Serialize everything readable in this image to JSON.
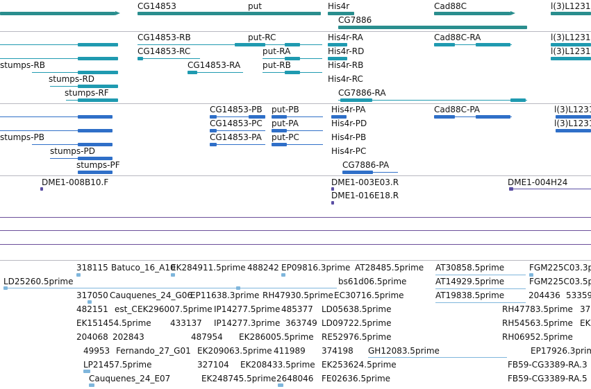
{
  "colors": {
    "gene": "#2a8e8e",
    "rna": "#1f9ab0",
    "cds": "#2f6fc8",
    "clone": "#5b4fa4",
    "est": "#7fb6dc",
    "track_line": "#6b4e9a",
    "separator": "#b8b8c0"
  },
  "genes": [
    "CG14853",
    "put",
    "His4r",
    "CG7886",
    "Cad88C",
    "l(3)L1231"
  ],
  "transcripts": [
    "CG14853-RB",
    "put-RC",
    "His4r-RA",
    "Cad88C-RA",
    "l(3)L1231",
    "CG14853-RC",
    "put-RA",
    "His4r-RD",
    "l(3)L1231",
    "stumps-RB",
    "CG14853-RA",
    "put-RB",
    "His4r-RB",
    "stumps-RD",
    "His4r-RC",
    "stumps-RF",
    "CG7886-RA"
  ],
  "proteins": [
    "CG14853-PB",
    "put-PB",
    "His4r-PA",
    "Cad88C-PA",
    "l(3)L1231",
    "CG14853-PC",
    "put-PA",
    "His4r-PD",
    "l(3)L1231",
    "stumps-PB",
    "CG14853-PA",
    "put-PC",
    "His4r-PB",
    "stumps-PD",
    "His4r-PC",
    "stumps-PF",
    "CG7886-PA"
  ],
  "clones": [
    "DME1-008B10.F",
    "DME1-003E03.R",
    "DME1-004H24",
    "DME1-016E18.R"
  ],
  "ests": [
    "318115",
    "Batuco_16_A10",
    "EK284911.5prime",
    "488242",
    "EP09816.3prime",
    "AT28485.5prime",
    "AT30858.5prime",
    "FGM225C03.3p",
    "LD25260.5prime",
    "bs61d06.5prime",
    "317050",
    "Cauquenes_24_G06",
    "EP11638.3prime",
    "RH47930.5prime",
    "EC30716.5prime",
    "AT14929.5prime",
    "FGM225C03.5p",
    "482151",
    "est_C",
    "EK296007.5prime",
    "IP14277.5prime",
    "485377",
    "LD05638.5prime",
    "AT19838.5prime",
    "204436",
    "53359",
    "EK151454.5prime",
    "433137",
    "IP14277.3prime",
    "363749",
    "LD09722.5prime",
    "RH47783.5prime",
    "37",
    "204068",
    "202843",
    "487954",
    "EK286005.5prime",
    "RE52976.5prime",
    "RH54563.5prime",
    "EK",
    "49953",
    "Fernando_27_G01",
    "EK209063.5prime",
    "411989",
    "374198",
    "GH12083.5prime",
    "RH06952.5prime",
    "EP17926.3prim",
    "LP21457.5prime",
    "327104",
    "EK208433.5prime",
    "EK253624.5prime",
    "FB59-CG3389-RA.3",
    "Cauquenes_24_E07",
    "EK248745.5prime",
    "2648046",
    "FE02636.5prime",
    "FB59-CG3389-RA.5"
  ]
}
